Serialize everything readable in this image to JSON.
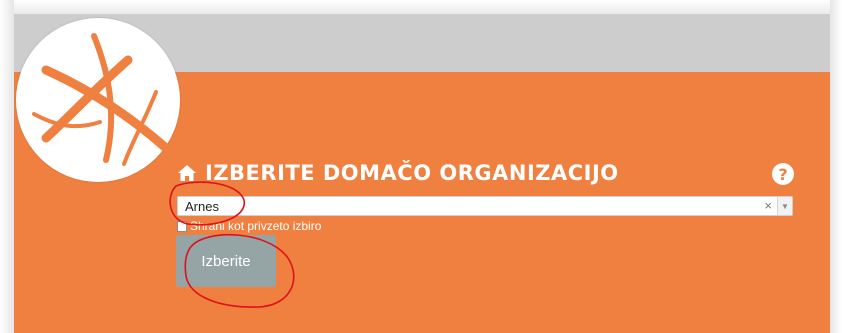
{
  "heading": {
    "title": "IZBERITE DOMAČO ORGANIZACIJO"
  },
  "help": {
    "label": "?"
  },
  "select": {
    "value": "Arnes",
    "clear_glyph": "×",
    "arrow_glyph": "▼"
  },
  "remember": {
    "label": "Shrani kot privzeto izbiro"
  },
  "submit": {
    "label": "Izberite"
  },
  "icons": {
    "home": "home-icon",
    "help": "help-icon",
    "logo": "logo-icon"
  },
  "colors": {
    "brand_orange": "#ef8040",
    "button_gray": "#95a5a6",
    "annotation_red": "#e0101a"
  }
}
